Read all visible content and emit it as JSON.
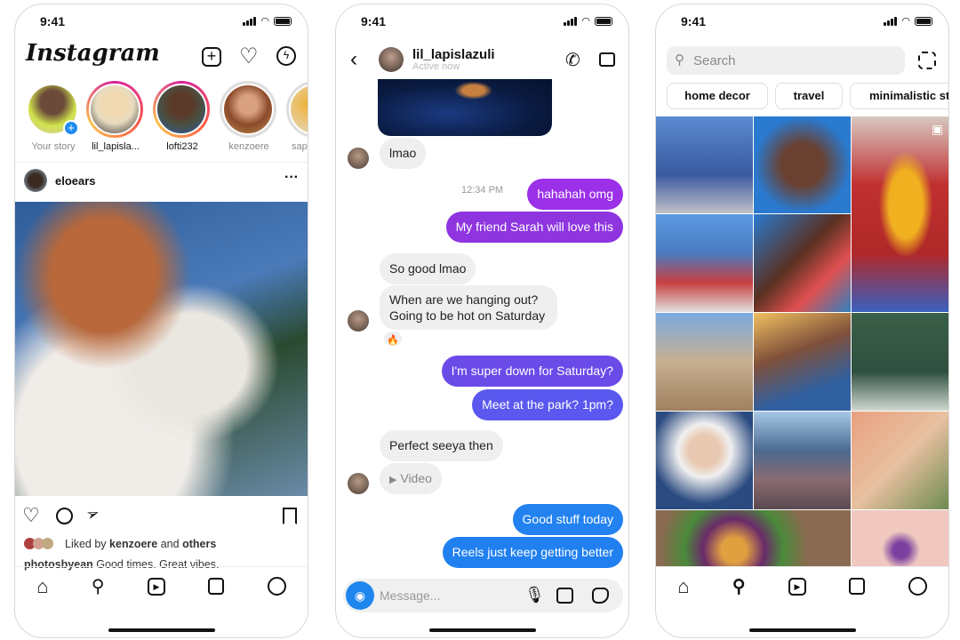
{
  "status_time": "9:41",
  "feed": {
    "logo": "Instagram",
    "stories": [
      {
        "name": "Your story"
      },
      {
        "name": "lil_lapisla..."
      },
      {
        "name": "lofti232"
      },
      {
        "name": "kenzoere"
      },
      {
        "name": "sapp"
      }
    ],
    "post": {
      "author": "eloears",
      "liked_by_prefix": "Liked by",
      "liked_by_user": "kenzoere",
      "liked_by_and": "and",
      "liked_by_others": "others",
      "caption_user": "photosbyean",
      "caption_text": "Good times. Great vibes."
    }
  },
  "chat": {
    "username": "lil_lapislazuli",
    "status": "Active now",
    "timestamp": "12:34 PM",
    "messages": [
      {
        "text": "lmao",
        "from": "them"
      },
      {
        "text": "hahahah omg",
        "from": "me"
      },
      {
        "text": "My friend Sarah will love this",
        "from": "me"
      },
      {
        "text": "So good lmao",
        "from": "them"
      },
      {
        "text": "When are we hanging out?",
        "from": "them"
      },
      {
        "text": "Going to be hot on Saturday",
        "from": "them"
      },
      {
        "text": "🔥",
        "from": "them"
      },
      {
        "text": "I'm super down for Saturday?",
        "from": "me"
      },
      {
        "text": "Meet at the park? 1pm?",
        "from": "me"
      },
      {
        "text": "Perfect seeya then",
        "from": "them"
      },
      {
        "text": "Video",
        "from": "them"
      },
      {
        "text": "Good stuff today",
        "from": "me"
      },
      {
        "text": "Reels just keep getting better",
        "from": "me"
      }
    ],
    "composer_placeholder": "Message...",
    "colors": {
      "purple": "#9b30e8",
      "violet": "#6a4be8",
      "blue": "#2080f0"
    }
  },
  "explore": {
    "search_placeholder": "Search",
    "chips": [
      "home decor",
      "travel",
      "minimalistic sty"
    ]
  }
}
